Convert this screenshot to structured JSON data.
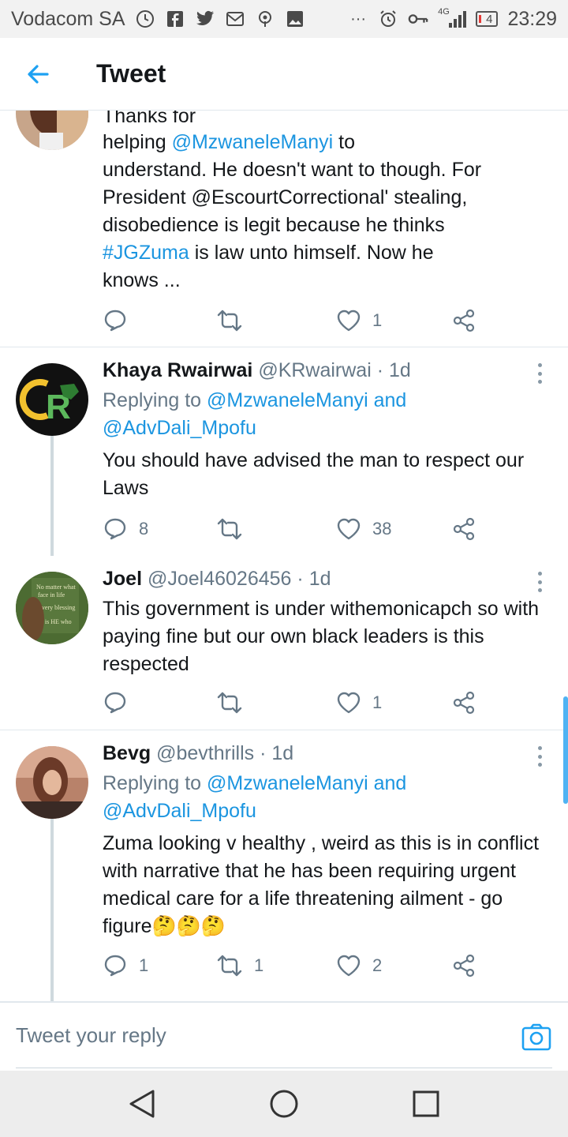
{
  "status_bar": {
    "carrier": "Vodacom SA",
    "network": "4G",
    "battery": "4",
    "time": "23:29",
    "icons": [
      "sync-icon",
      "facebook-icon",
      "twitter-icon",
      "gmail-icon",
      "podcast-icon",
      "gallery-icon",
      "more-dots-icon",
      "alarm-icon",
      "key-icon",
      "signal-icon",
      "battery-icon"
    ]
  },
  "header": {
    "title": "Tweet",
    "back_icon": "back-arrow-icon"
  },
  "tweets": [
    {
      "body_top_partial": "Thanks for",
      "body_line1_prefix": "helping ",
      "body_mention1": "@MzwaneleManyi",
      "body_line1_suffix": " to",
      "body_line2": "understand. He doesn't want to though. For",
      "body_line3": "President @EscourtCorrectional' stealing,",
      "body_line4": "disobedience is legit because he thinks",
      "body_hashtag": "#JGZuma",
      "body_line5_suffix": " is law unto himself. Now he",
      "body_line6": "knows  ...",
      "replies": "",
      "retweets": "",
      "likes": "1"
    },
    {
      "name": "Khaya Rwairwai",
      "handle": "@KRwairwai",
      "time": "· 1d",
      "replying_prefix": "Replying to ",
      "replying_to1": "@MzwaneleManyi",
      "replying_and": " and",
      "replying_to2": "@AdvDali_Mpofu",
      "body": "You should have advised the man to respect our Laws",
      "replies": "8",
      "retweets": "",
      "likes": "38"
    },
    {
      "name": "Joel",
      "handle": "@Joel46026456",
      "time": "· 1d",
      "body": "This government is under withemonicapch so with paying fine but our own black leaders is this respected",
      "replies": "",
      "retweets": "",
      "likes": "1"
    },
    {
      "name": "Bevg",
      "handle": "@bevthrills",
      "time": "· 1d",
      "replying_prefix": "Replying to ",
      "replying_to1": "@MzwaneleManyi",
      "replying_and": " and",
      "replying_to2": "@AdvDali_Mpofu",
      "body": "Zuma looking v healthy , weird as this is in conflict with narrative that he has been requiring urgent medical care for a life threatening ailment - go figure",
      "body_emoji": "🤔🤔🤔",
      "replies": "1",
      "retweets": "1",
      "likes": "2"
    }
  ],
  "reply_bar": {
    "placeholder": "Tweet your reply"
  },
  "nav": {
    "back_icon": "nav-back-icon",
    "home_icon": "nav-home-icon",
    "recents_icon": "nav-recents-icon"
  },
  "colors": {
    "accent": "#1da1f2",
    "mention": "#1b95e0",
    "secondary_text": "#657786",
    "divider": "#e1e8ed"
  }
}
